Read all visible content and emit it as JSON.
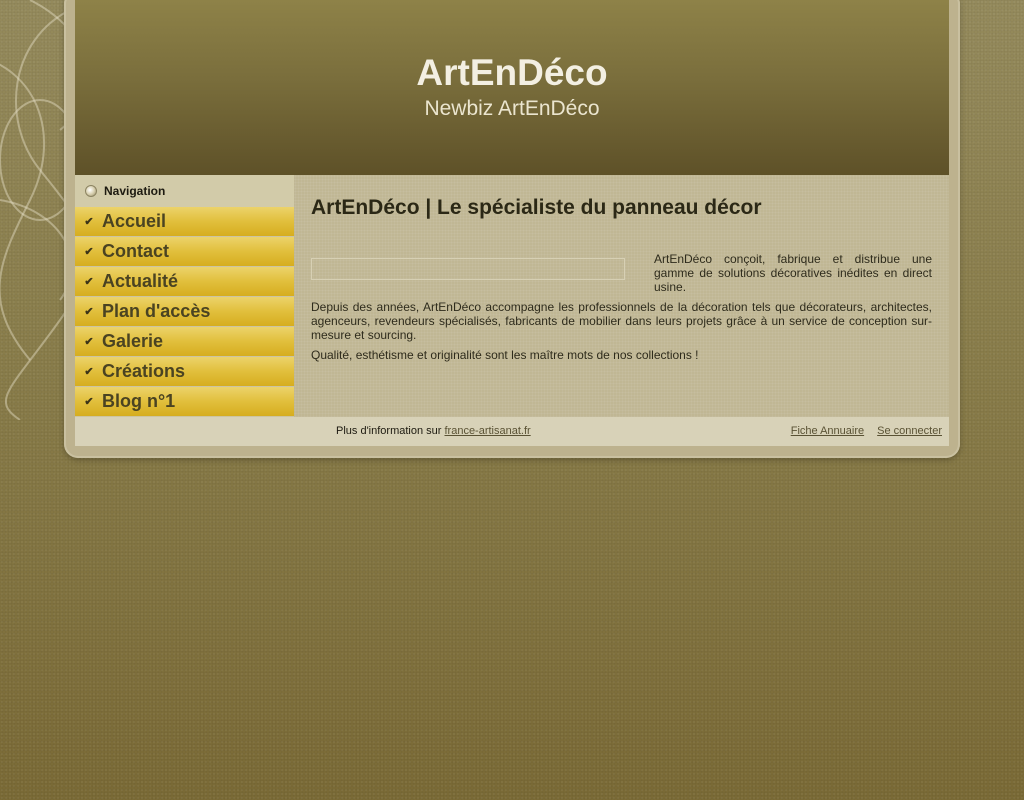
{
  "header": {
    "title": "ArtEnDéco",
    "subtitle": "Newbiz ArtEnDéco"
  },
  "sidebar": {
    "heading": "Navigation",
    "items": [
      {
        "label": "Accueil"
      },
      {
        "label": "Contact"
      },
      {
        "label": "Actualité"
      },
      {
        "label": "Plan d'accès"
      },
      {
        "label": "Galerie"
      },
      {
        "label": "Créations"
      },
      {
        "label": "Blog n°1"
      }
    ]
  },
  "main": {
    "title": "ArtEnDéco | Le spécialiste du panneau décor",
    "paragraphs": [
      "ArtEnDéco conçoit, fabrique et distribue une gamme de solutions décoratives inédites en direct usine.",
      "Depuis des années, ArtEnDéco accompagne les professionnels de la décoration tels que décorateurs, architectes, agenceurs, revendeurs spécialisés, fabricants de mobilier dans leurs projets grâce à un service de conception sur-mesure et sourcing.",
      "Qualité, esthétisme et originalité sont les maître mots de nos collections !"
    ]
  },
  "footer": {
    "info_text": "Plus d'information sur ",
    "info_link": "france-artisanat.fr",
    "links": [
      {
        "label": "Fiche Annuaire"
      },
      {
        "label": "Se connecter"
      }
    ]
  },
  "colors": {
    "nav_item": "#e1bf3c",
    "header_top": "#8e8248",
    "header_bottom": "#5e5128",
    "content_bg": "#c0b794"
  }
}
